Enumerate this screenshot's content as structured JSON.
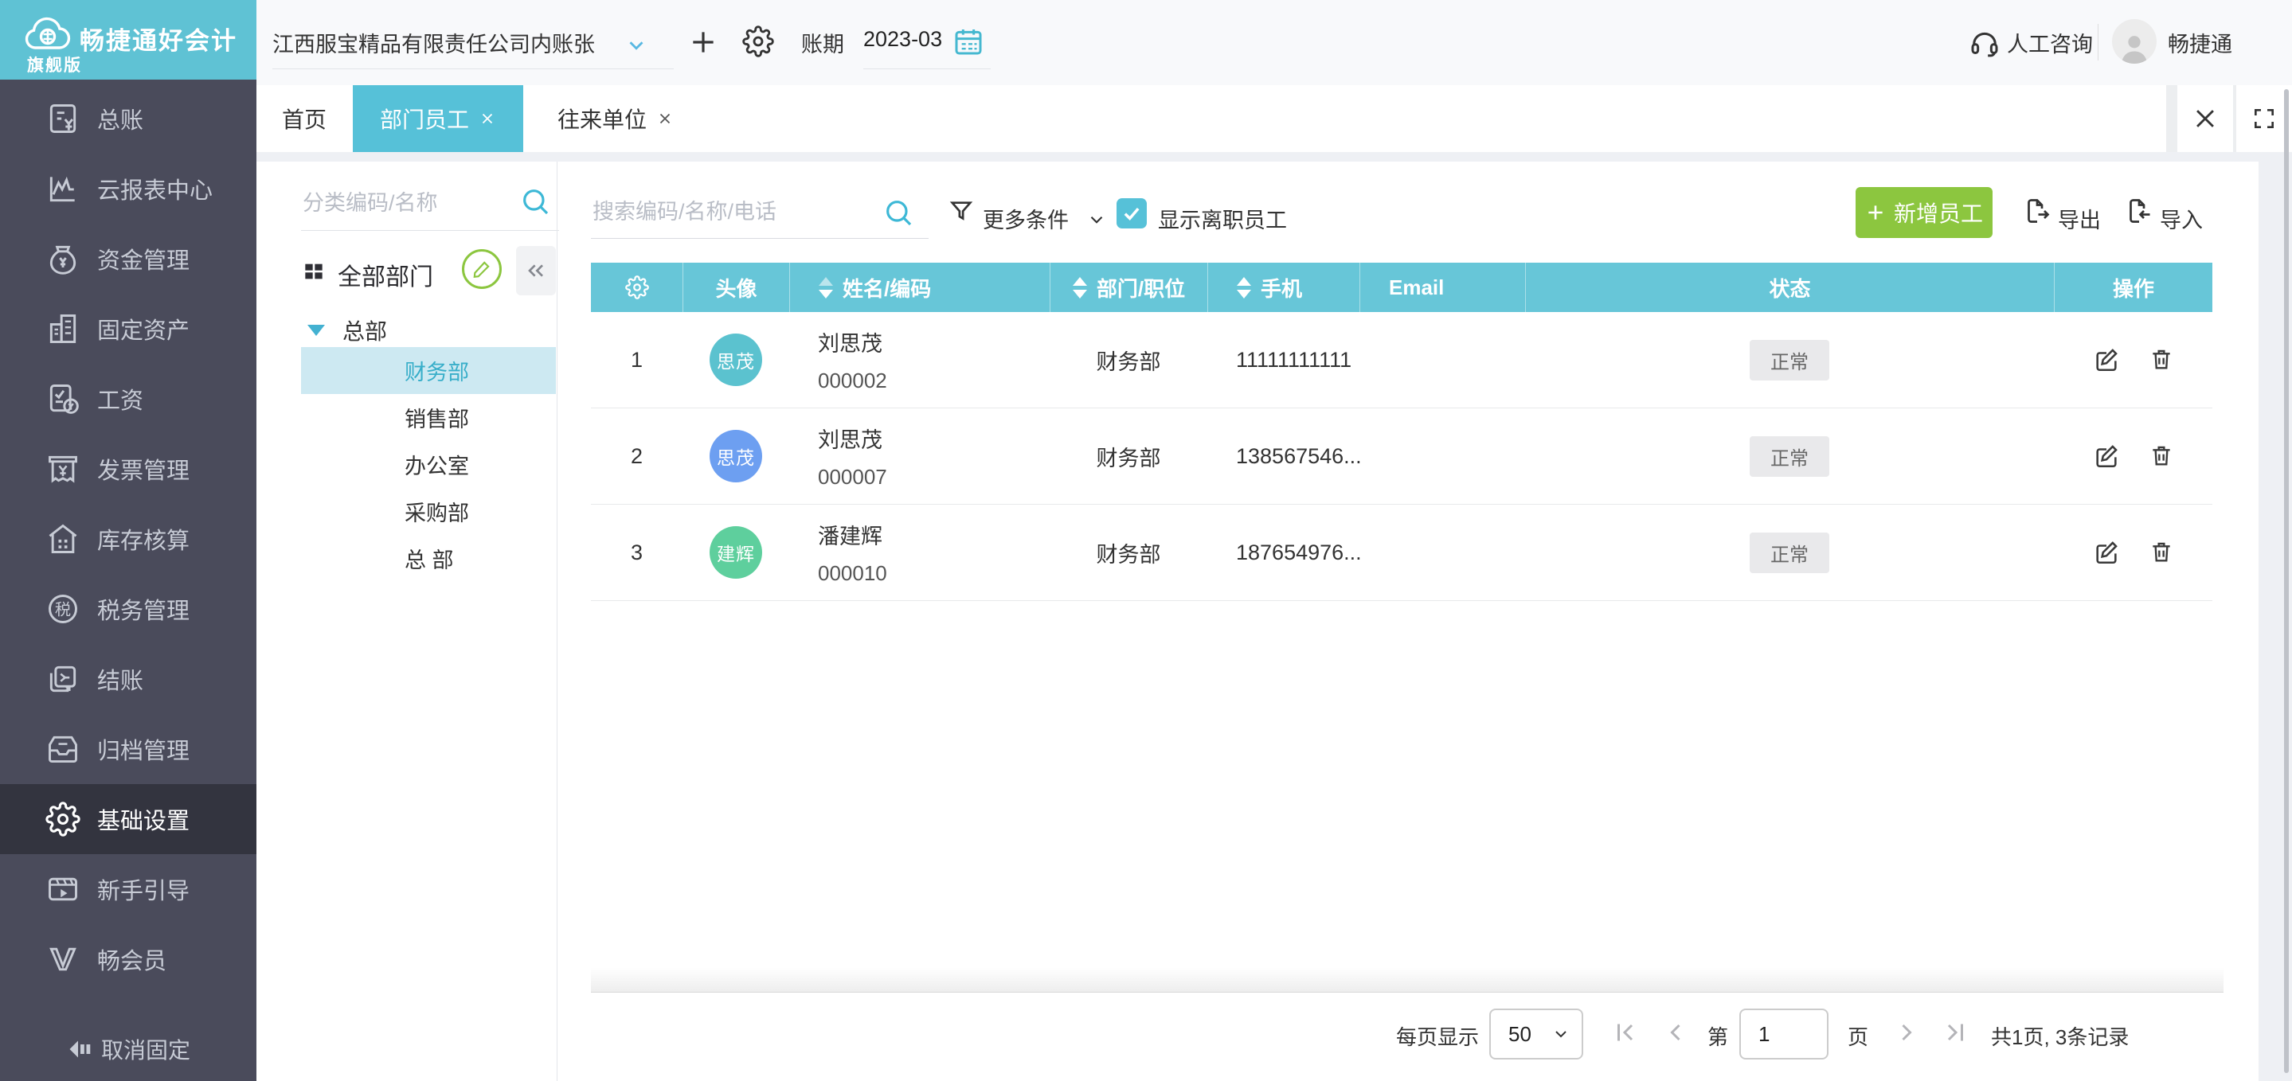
{
  "brand": {
    "title": "畅捷通好会计",
    "edition": "旗舰版"
  },
  "topbar": {
    "company": "江西服宝精品有限责任公司内账张",
    "period_label": "账期",
    "period_value": "2023-03",
    "support_label": "人工咨询",
    "username": "畅捷通"
  },
  "tabs": {
    "home": "首页",
    "active": "部门员工",
    "third": "往来单位"
  },
  "sidebar": {
    "items": [
      {
        "label": "总账"
      },
      {
        "label": "云报表中心"
      },
      {
        "label": "资金管理"
      },
      {
        "label": "固定资产"
      },
      {
        "label": "工资"
      },
      {
        "label": "发票管理"
      },
      {
        "label": "库存核算"
      },
      {
        "label": "税务管理"
      },
      {
        "label": "结账"
      },
      {
        "label": "归档管理"
      },
      {
        "label": "基础设置"
      },
      {
        "label": "新手引导"
      },
      {
        "label": "畅会员"
      }
    ],
    "unpin_label": "取消固定"
  },
  "tree": {
    "search_placeholder": "分类编码/名称",
    "root_label": "全部部门",
    "parent_node": "总部",
    "children": [
      "财务部",
      "销售部",
      "办公室",
      "采购部",
      "总 部"
    ],
    "selected": "财务部"
  },
  "toolbar": {
    "search_placeholder": "搜索编码/名称/电话",
    "more_filter_label": "更多条件",
    "show_resigned_label": "显示离职员工",
    "add_button": "新增员工",
    "export_label": "导出",
    "import_label": "导入"
  },
  "table": {
    "columns": {
      "avatar": "头像",
      "name_code": "姓名/编码",
      "dept_title": "部门/职位",
      "phone": "手机",
      "email": "Email",
      "status": "状态",
      "ops": "操作"
    },
    "rows": [
      {
        "index": "1",
        "avatar_text": "思茂",
        "name": "刘思茂",
        "code": "000002",
        "department": "财务部",
        "phone": "11111111111",
        "email": "",
        "status": "正常"
      },
      {
        "index": "2",
        "avatar_text": "思茂",
        "name": "刘思茂",
        "code": "000007",
        "department": "财务部",
        "phone": "138567546...",
        "email": "",
        "status": "正常"
      },
      {
        "index": "3",
        "avatar_text": "建辉",
        "name": "潘建辉",
        "code": "000010",
        "department": "财务部",
        "phone": "187654976...",
        "email": "",
        "status": "正常"
      }
    ]
  },
  "pagination": {
    "per_page_label": "每页显示",
    "per_page_value": "50",
    "page_prefix": "第",
    "page_value": "1",
    "page_suffix": "页",
    "summary": "共1页, 3条记录"
  },
  "colors": {
    "brand_teal": "#5fc2d4",
    "accent_teal": "#56c1d8",
    "table_header_teal": "#67c6d8",
    "sidebar_bg": "#4a4b5b",
    "sidebar_active_bg": "#33343f",
    "primary_green": "#8cc63f",
    "tree_selected_bg": "#cde9f2",
    "tree_selected_text": "#38aec9",
    "badge_bg": "#e9e9eb",
    "avatar_colors": [
      "#5bc2cf",
      "#6d9ff1",
      "#5ecf9d"
    ]
  }
}
